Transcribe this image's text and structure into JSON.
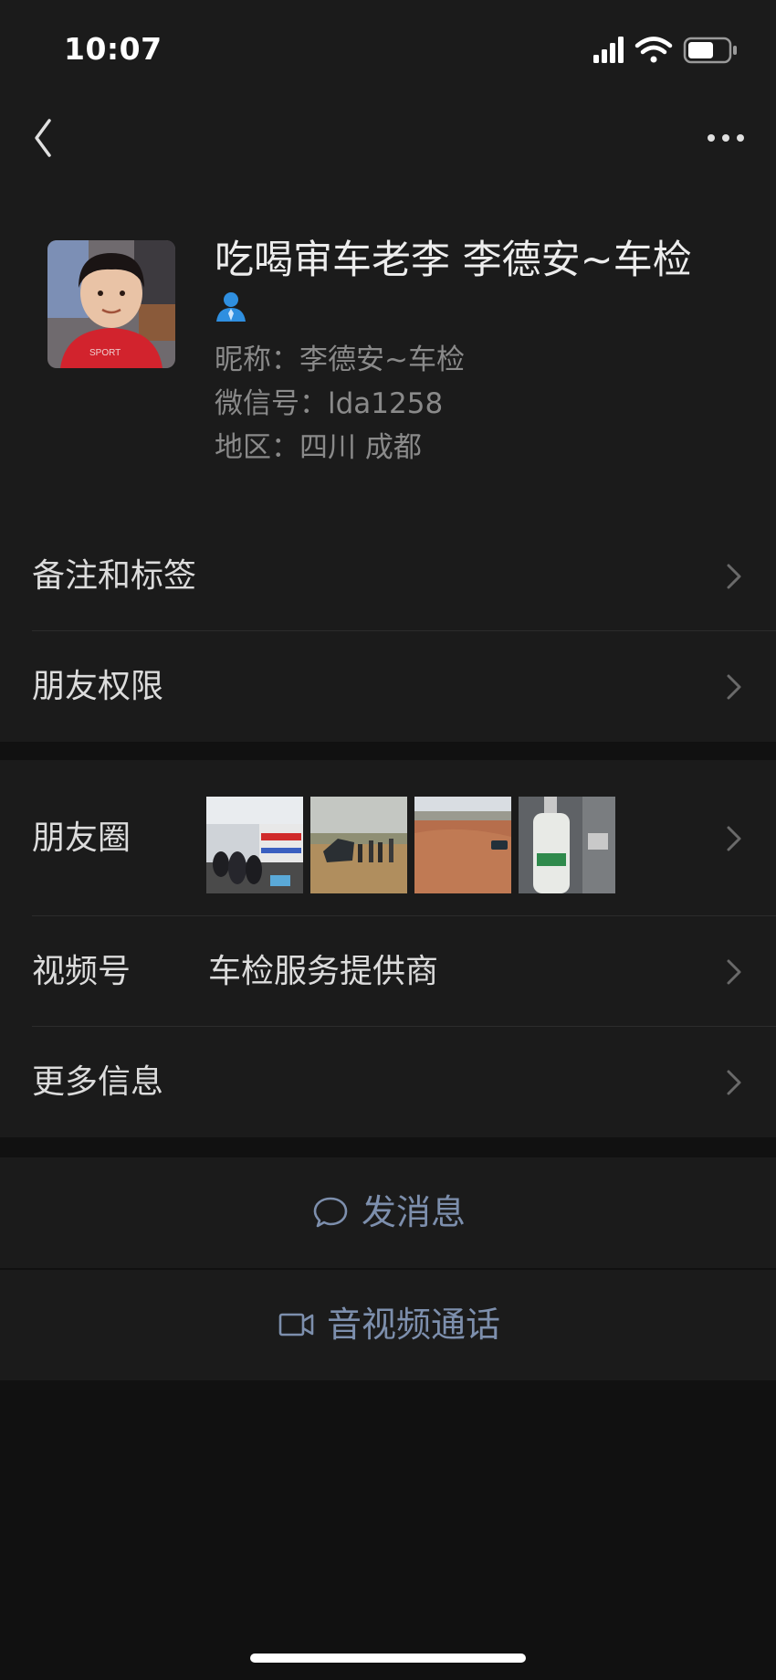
{
  "status_bar": {
    "time": "10:07",
    "signal_icon": "signal-icon",
    "wifi_icon": "wifi-icon",
    "battery_icon": "battery-icon"
  },
  "nav": {
    "back_icon": "chevron-left-icon",
    "more_icon": "more-horizontal-icon"
  },
  "profile": {
    "display_name": "吃喝审车老李  李德安~车检",
    "badge_icon": "user-badge-icon",
    "nickname": "昵称：李德安~车检",
    "wechat_id": "微信号：lda1258",
    "region": "地区：四川 成都"
  },
  "menu": {
    "remark_tags": "备注和标签",
    "permissions": "朋友权限",
    "moments": "朋友圈",
    "channels_label": "视频号",
    "channels_value": "车检服务提供商",
    "more_info": "更多信息"
  },
  "actions": {
    "message": "发消息",
    "message_icon": "chat-bubble-icon",
    "call": "音视频通话",
    "call_icon": "video-camera-icon"
  },
  "colors": {
    "background": "#111111",
    "panel": "#1b1b1b",
    "action_text": "#7d8fad",
    "badge": "#2f8fe0"
  }
}
